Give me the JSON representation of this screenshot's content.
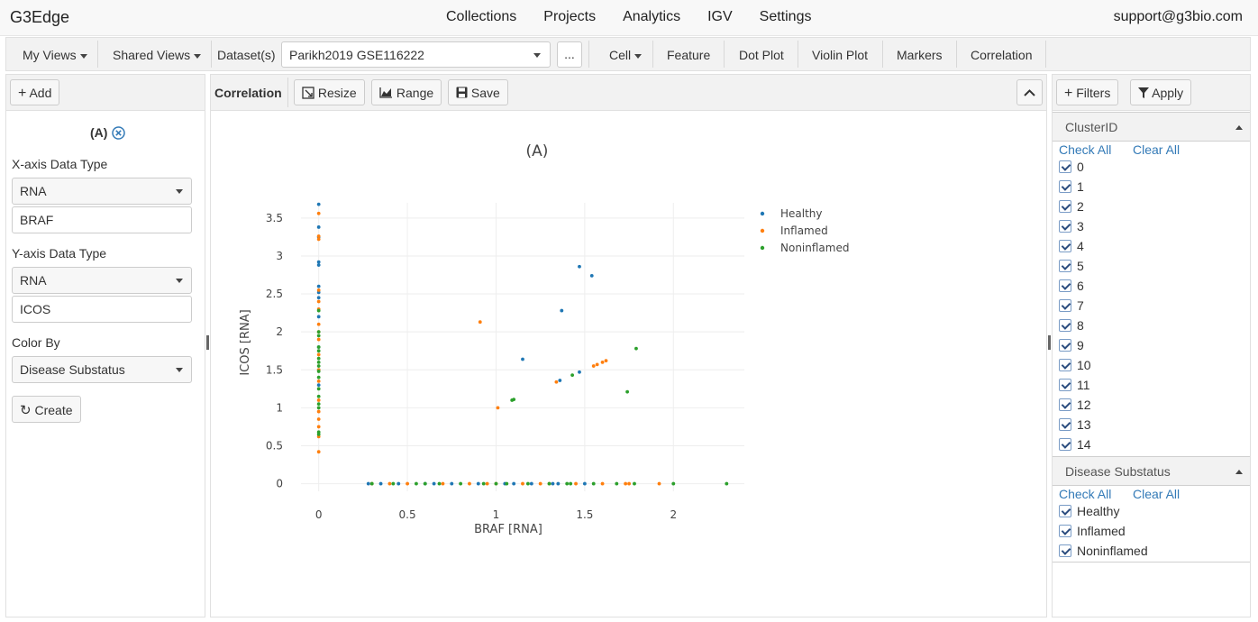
{
  "app": {
    "brand": "G3Edge",
    "support_email": "support@g3bio.com"
  },
  "nav": {
    "items": [
      "Collections",
      "Projects",
      "Analytics",
      "IGV",
      "Settings"
    ]
  },
  "toolbar": {
    "my_views": "My Views",
    "shared_views": "Shared Views",
    "datasets_label": "Dataset(s)",
    "dataset_value": "Parikh2019 GSE116222",
    "more_label": "...",
    "cell": "Cell",
    "feature": "Feature",
    "dot_plot": "Dot Plot",
    "violin_plot": "Violin Plot",
    "markers": "Markers",
    "correlation": "Correlation"
  },
  "left": {
    "add_label": "Add",
    "plot_id": "(A)",
    "x_type_label": "X-axis Data Type",
    "x_type_value": "RNA",
    "x_feature": "BRAF",
    "y_type_label": "Y-axis Data Type",
    "y_type_value": "RNA",
    "y_feature": "ICOS",
    "color_by_label": "Color By",
    "color_by_value": "Disease Substatus",
    "create_label": "Create"
  },
  "main": {
    "title": "Correlation",
    "resize_label": "Resize",
    "range_label": "Range",
    "save_label": "Save"
  },
  "right": {
    "filters_label": "Filters",
    "apply_label": "Apply",
    "cluster_title": "ClusterID",
    "check_all": "Check All",
    "clear_all": "Clear All",
    "clusters": [
      "0",
      "1",
      "2",
      "3",
      "4",
      "5",
      "6",
      "7",
      "8",
      "9",
      "10",
      "11",
      "12",
      "13",
      "14"
    ],
    "disease_title": "Disease Substatus",
    "disease_items": [
      "Healthy",
      "Inflamed",
      "Noninflamed"
    ]
  },
  "chart_data": {
    "type": "scatter",
    "title": "(A)",
    "xlabel": "BRAF [RNA]",
    "ylabel": "ICOS [RNA]",
    "xlim": [
      -0.1,
      2.4
    ],
    "ylim": [
      -0.1,
      3.7
    ],
    "x_ticks": [
      "0",
      "0.5",
      "1",
      "1.5",
      "2"
    ],
    "x_tick_values": [
      0,
      0.5,
      1,
      1.5,
      2
    ],
    "y_ticks": [
      "0",
      "0.5",
      "1",
      "1.5",
      "2",
      "2.5",
      "3",
      "3.5"
    ],
    "y_tick_values": [
      0,
      0.5,
      1,
      1.5,
      2,
      2.5,
      3,
      3.5
    ],
    "grid": true,
    "legend_position": "top-right",
    "series": [
      {
        "name": "Healthy",
        "color": "#1f77b4",
        "x": [
          0,
          0,
          0,
          0,
          0,
          0,
          0,
          0,
          0,
          0,
          0,
          0,
          0.28,
          0.45,
          0.6,
          0.75,
          0.9,
          1.05,
          1.2,
          1.35,
          1.5,
          0.35,
          0.65,
          1.1,
          1.15,
          1.37,
          1.36,
          1.47,
          1.54,
          1.47,
          1.32
        ],
        "y": [
          3.68,
          3.38,
          3.25,
          2.92,
          2.88,
          2.6,
          2.52,
          2.45,
          2.2,
          1.8,
          1.5,
          1.3,
          0,
          0,
          0,
          0,
          0,
          0,
          0,
          0,
          0,
          0,
          0,
          0,
          1.64,
          2.28,
          1.36,
          2.86,
          2.74,
          1.47,
          0
        ]
      },
      {
        "name": "Inflamed",
        "color": "#ff7f0e",
        "x": [
          0,
          0,
          0,
          0,
          0,
          0,
          0,
          0,
          0,
          0,
          0,
          0,
          0,
          0,
          0,
          0,
          0,
          0,
          0.3,
          0.5,
          0.7,
          0.85,
          1.0,
          1.15,
          1.3,
          1.45,
          1.6,
          1.75,
          1.92,
          0.4,
          0.95,
          1.25,
          0.91,
          1.01,
          1.34,
          1.55,
          1.57,
          1.6,
          1.62,
          1.73
        ],
        "y": [
          3.56,
          3.26,
          3.22,
          2.55,
          2.4,
          2.3,
          2.1,
          2.0,
          1.9,
          1.7,
          1.5,
          1.35,
          1.1,
          0.95,
          0.85,
          0.75,
          0.62,
          0.42,
          0,
          0,
          0,
          0,
          0,
          0,
          0,
          0,
          0,
          0,
          0,
          0,
          0,
          0,
          2.13,
          1.0,
          1.34,
          1.55,
          1.57,
          1.6,
          1.62,
          0
        ]
      },
      {
        "name": "Noninflamed",
        "color": "#2ca02c",
        "x": [
          0,
          0,
          0,
          0,
          0,
          0,
          0,
          0,
          0,
          0,
          0,
          0,
          0,
          0,
          0,
          0,
          0.3,
          0.42,
          0.55,
          0.68,
          0.8,
          0.93,
          1.06,
          1.18,
          1.3,
          1.42,
          1.55,
          1.68,
          1.78,
          2.0,
          2.3,
          0.6,
          1.0,
          1.4,
          1.09,
          1.1,
          1.43,
          1.74,
          1.79
        ],
        "y": [
          2.28,
          2.0,
          1.95,
          1.8,
          1.75,
          1.65,
          1.6,
          1.55,
          1.48,
          1.4,
          1.25,
          1.15,
          1.05,
          1.0,
          0.68,
          0.65,
          0,
          0,
          0,
          0,
          0,
          0,
          0,
          0,
          0,
          0,
          0,
          0,
          0,
          0,
          0,
          0,
          0,
          0,
          1.1,
          1.11,
          1.43,
          1.21,
          1.78
        ]
      }
    ]
  }
}
